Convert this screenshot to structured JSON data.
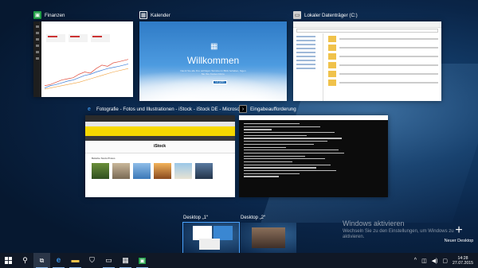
{
  "windows": {
    "finanzen": {
      "title": "Finanzen"
    },
    "kalender": {
      "title": "Kalender",
      "welcome": "Willkommen",
      "subtitle": "Damit Sie alle Ihre wichtigen Termine im Blick behalten, fügen Sie Ihre Konten hinzu.",
      "button": "Los geht's"
    },
    "explorer": {
      "title": "Lokaler Datenträger (C:)"
    },
    "browser": {
      "title": "Fotografie - Fotos und Illustrationen - iStock - iStock DE - Microsoft...",
      "logo": "iStock",
      "section": "Beliebte Stock-Photos"
    },
    "cmd": {
      "title": "Eingabeaufforderung"
    }
  },
  "desktops": [
    {
      "label": "Desktop „1“"
    },
    {
      "label": "Desktop „2“"
    }
  ],
  "new_desktop": {
    "label": "Neuer Desktop"
  },
  "activation": {
    "title": "Windows aktivieren",
    "text": "Wechseln Sie zu den Einstellungen, um Windows zu aktivieren."
  },
  "taskbar": {
    "time": "14:28",
    "date": "27.07.2015"
  }
}
